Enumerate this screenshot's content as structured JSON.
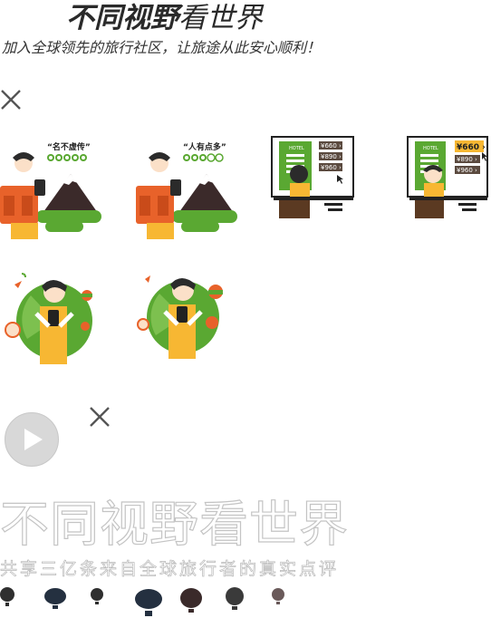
{
  "header": {
    "title_bold": "不同视野",
    "title_light": "看世界",
    "subtitle": "加入全球领先的旅行社区，让旅途从此安心顺利！"
  },
  "illustrations": {
    "review_one": {
      "quote": "“名不虚传”"
    },
    "review_two": {
      "quote": "“人有点多”"
    },
    "hotel_one": {
      "sign": "HOTEL",
      "prices": [
        "¥660 ›",
        "¥890 ›",
        "¥960 ›"
      ]
    },
    "hotel_two": {
      "sign": "HOTEL",
      "prices": [
        "¥660 ›",
        "¥890 ›",
        "¥960 ›"
      ]
    }
  },
  "promo": {
    "title": "不同视野看世界",
    "subtitle": "共享三亿条来自全球旅行者的真实点评"
  },
  "colors": {
    "green": "#5aa832",
    "dark_green": "#2e7d32",
    "orange": "#e8622a",
    "yellow": "#f7b733",
    "mountain": "#3b2a2a",
    "price_tag": "#5b4a3f",
    "highlight": "#f7b733"
  },
  "icons": [
    "close-icon",
    "close-icon",
    "play-icon",
    "balloon-icon"
  ]
}
